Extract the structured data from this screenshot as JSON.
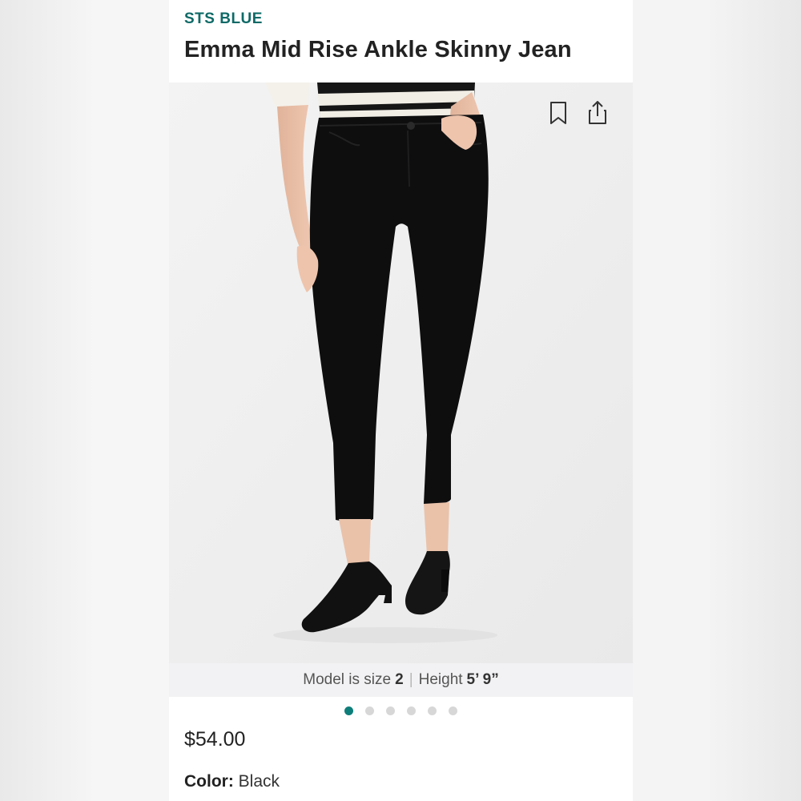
{
  "product": {
    "brand": "STS BLUE",
    "title": "Emma Mid Rise Ankle Skinny Jean",
    "price": "$54.00",
    "color_label": "Color:",
    "color_value": "Black"
  },
  "photo": {
    "toolbar_icons": [
      "bookmark-icon",
      "share-icon"
    ],
    "caption": {
      "size_prefix": "Model is size",
      "size_value": "2",
      "separator": "|",
      "height_prefix": "Height",
      "height_value": "5’ 9”"
    }
  },
  "carousel": {
    "total": 6,
    "active_index": 0
  },
  "colors": {
    "brand": "#0e6a67",
    "active_dot": "#0e7e7a",
    "inactive_dot": "#d7d7d7"
  }
}
